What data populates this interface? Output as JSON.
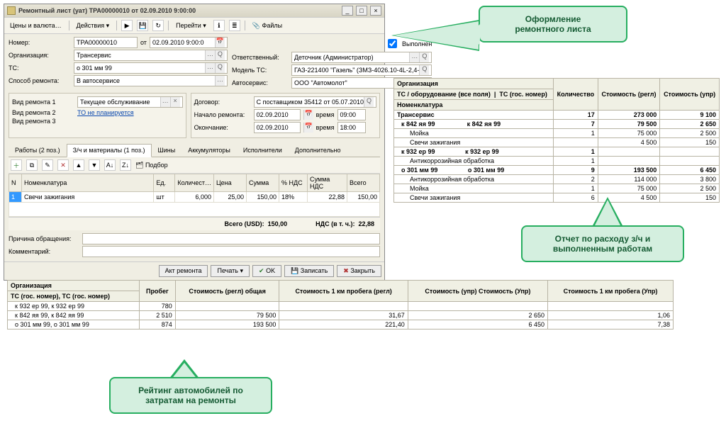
{
  "window": {
    "title": "Ремонтный лист (уат) ТРА00000010 от 02.09.2010 9:00:00",
    "menu": {
      "prices": "Цены и валюта…",
      "actions": "Действия",
      "go": "Перейти",
      "files": "Файлы"
    }
  },
  "form": {
    "number_label": "Номер:",
    "number": "ТРА00000010",
    "from": "от",
    "date": "02.09.2010 9:00:0",
    "done_label": "Выполнен",
    "org_label": "Организация:",
    "org": "Трансервис",
    "ts_label": "ТС:",
    "ts": "о 301 мм 99",
    "method_label": "Способ ремонта:",
    "method": "В автосервисе",
    "resp_label": "Ответственный:",
    "resp": "Деточник (Администратор)",
    "model_label": "Модель ТС:",
    "model": "ГАЗ-221400 \"Газель\" (ЗМЗ-4026.10-4L-2,4-",
    "service_label": "Автосервис:",
    "service": "ООО \"Автомолот\"",
    "contract_label": "Договор:",
    "contract": "С поставщиком 35412 от 05.07.2010",
    "start_label": "Начало ремонта:",
    "start_date": "02.09.2010",
    "time_label": "время",
    "start_time": "09:00",
    "end_label": "Окончание:",
    "end_date": "02.09.2010",
    "end_time": "18:00",
    "kind1_label": "Вид ремонта 1",
    "kind1": "Текущее обслуживание",
    "kind2_label": "Вид ремонта 2",
    "to_link": "ТО не планируется",
    "kind3_label": "Вид ремонта 3"
  },
  "tabs": {
    "t1": "Работы (2 поз.)",
    "t2": "З/ч и материалы (1 поз.)",
    "t3": "Шины",
    "t4": "Аккумуляторы",
    "t5": "Исполнители",
    "t6": "Дополнительно"
  },
  "subtool": {
    "podbor": "Подбор"
  },
  "grid": {
    "h_n": "N",
    "h_item": "Номенклатура",
    "h_unit": "Ед.",
    "h_qty": "Количест…",
    "h_price": "Цена",
    "h_sum": "Сумма",
    "h_vat": "% НДС",
    "h_vatsum": "Сумма НДС",
    "h_total": "Всего",
    "r1_n": "1",
    "r1_item": "Свечи зажигания",
    "r1_unit": "шт",
    "r1_qty": "6,000",
    "r1_price": "25,00",
    "r1_sum": "150,00",
    "r1_vat": "18%",
    "r1_vatsum": "22,88",
    "r1_total": "150,00"
  },
  "totals": {
    "total_lbl": "Всего (USD):",
    "total": "150,00",
    "vat_lbl": "НДС (в т. ч.):",
    "vat": "22,88"
  },
  "bottom": {
    "reason_label": "Причина обращения:",
    "comment_label": "Комментарий:",
    "act": "Акт ремонта",
    "print": "Печать",
    "ok": "OK",
    "save": "Записать",
    "close": "Закрыть"
  },
  "callouts": {
    "c1a": "Оформление",
    "c1b": "ремонтного листа",
    "c2a": "Отчет по расходу з/ч и",
    "c2b": "выполненным работам",
    "c3a": "Рейтинг автомобилей по",
    "c3b": "затратам на ремонты"
  },
  "rep1": {
    "h_org": "Организация",
    "h_qty": "Количество",
    "h_regl": "Стоимость (регл)",
    "h_upr": "Стоимость (упр)",
    "h_ts": "ТС / оборудование (все поля)",
    "h_gos": "ТС (гос. номер)",
    "h_nom": "Номенклатура",
    "r_org": "Трансервис",
    "r_org_q": "17",
    "r_org_r": "273 000",
    "r_org_u": "9 100",
    "r_v1": "к 842 яя 99",
    "r_v1g": "к 842 яя 99",
    "r_v1_q": "7",
    "r_v1_r": "79 500",
    "r_v1_u": "2 650",
    "r_v1a": "Мойка",
    "r_v1a_q": "1",
    "r_v1a_r": "75 000",
    "r_v1a_u": "2 500",
    "r_v1b": "Свечи зажигания",
    "r_v1b_r": "4 500",
    "r_v1b_u": "150",
    "r_v2": "к 932 ер 99",
    "r_v2g": "к 932 ер 99",
    "r_v2_q": "1",
    "r_v2a": "Антикоррозийная обработка",
    "r_v2a_q": "1",
    "r_v3": "о 301 мм 99",
    "r_v3g": "о 301 мм 99",
    "r_v3_q": "9",
    "r_v3_r": "193 500",
    "r_v3_u": "6 450",
    "r_v3a": "Антикоррозийная обработка",
    "r_v3a_q": "2",
    "r_v3a_r": "114 000",
    "r_v3a_u": "3 800",
    "r_v3b": "Мойка",
    "r_v3b_q": "1",
    "r_v3b_r": "75 000",
    "r_v3b_u": "2 500",
    "r_v3c": "Свечи зажигания",
    "r_v3c_q": "6",
    "r_v3c_r": "4 500",
    "r_v3c_u": "150"
  },
  "rep2": {
    "h_org": "Организация",
    "h_run": "Пробег",
    "h_regl": "Стоимость (регл) общая",
    "h_km_r": "Стоимость 1 км пробега (регл)",
    "h_upr": "Стоимость (упр) Стоимость (Упр)",
    "h_km_u": "Стоимость 1 км пробега (Упр)",
    "h_ts": "ТС (гос. номер), ТС (гос. номер)",
    "r1": "к 932 ер 99, к 932 ер 99",
    "r1_run": "780",
    "r2": "к 842 яя 99, к 842 яя 99",
    "r2_run": "2 510",
    "r2_r": "79 500",
    "r2_kmr": "31,67",
    "r2_u": "2 650",
    "r2_kmu": "1,06",
    "r3": "о 301 мм 99, о 301 мм 99",
    "r3_run": "874",
    "r3_r": "193 500",
    "r3_kmr": "221,40",
    "r3_u": "6 450",
    "r3_kmu": "7,38"
  }
}
